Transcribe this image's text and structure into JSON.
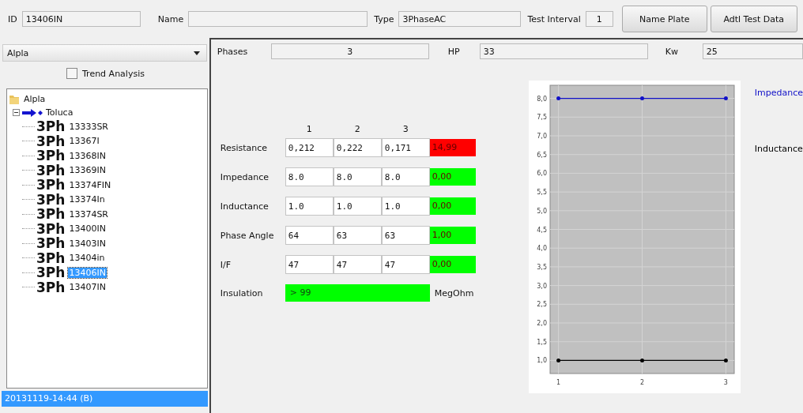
{
  "header": {
    "id_label": "ID",
    "id_value": "13406IN",
    "name_label": "Name",
    "type_label": "Type",
    "type_value": "3PhaseAC",
    "interval_label": "Test Interval",
    "interval_value": "1",
    "buttons": [
      "Name Plate",
      "Adtl Test Data"
    ]
  },
  "sidebar": {
    "site_select": "Alpla",
    "trend_analysis": {
      "label": "Trend Analysis",
      "checked": false
    },
    "tree": [
      {
        "label": "Alpla",
        "kind": "folder",
        "children": [
          {
            "label": "Toluca",
            "kind": "site",
            "expanded": true,
            "children": [
              {
                "type": "3Ph",
                "label": "13333SR",
                "selected": false
              },
              {
                "type": "3Ph",
                "label": "13367I",
                "selected": false
              },
              {
                "type": "3Ph",
                "label": "13368IN",
                "selected": false
              },
              {
                "type": "3Ph",
                "label": "13369IN",
                "selected": false
              },
              {
                "type": "3Ph",
                "label": "13374FIN",
                "selected": false
              },
              {
                "type": "3Ph",
                "label": "13374In",
                "selected": false
              },
              {
                "type": "3Ph",
                "label": "13374SR",
                "selected": false
              },
              {
                "type": "3Ph",
                "label": "13400IN",
                "selected": false
              },
              {
                "type": "3Ph",
                "label": "13403IN",
                "selected": false
              },
              {
                "type": "3Ph",
                "label": "13404in",
                "selected": false
              },
              {
                "type": "3Ph",
                "label": "13406IN",
                "selected": true
              },
              {
                "type": "3Ph",
                "label": "13407IN",
                "selected": false
              }
            ]
          }
        ]
      }
    ],
    "tests": [
      {
        "label": "20131119-14:44 (B)",
        "selected": true
      }
    ]
  },
  "motor": {
    "phases_label": "Phases",
    "phases_value": "3",
    "hp_label": "HP",
    "hp_value": "33",
    "kw_label": "Kw",
    "kw_value": "25"
  },
  "measurements": {
    "columns": [
      "1",
      "2",
      "3"
    ],
    "rows": [
      {
        "label": "Resistance",
        "values": [
          "0,212",
          "0,222",
          "0,171"
        ],
        "deviation": "14,99",
        "color": "#ff0000"
      },
      {
        "label": "Impedance",
        "values": [
          "8.0",
          "8.0",
          "8.0"
        ],
        "deviation": "0,00",
        "color": "#00ff00"
      },
      {
        "label": "Inductance",
        "values": [
          "1.0",
          "1.0",
          "1.0"
        ],
        "deviation": "0,00",
        "color": "#00ff00"
      },
      {
        "label": "Phase Angle",
        "values": [
          "64",
          "63",
          "63"
        ],
        "deviation": "1,00",
        "color": "#00ff00"
      },
      {
        "label": "I/F",
        "values": [
          "47",
          "47",
          "47"
        ],
        "deviation": "0,00",
        "color": "#00ff00"
      }
    ],
    "insulation": {
      "label": "Insulation",
      "value": "> 99",
      "unit": "MegOhm",
      "color": "#00ff00"
    }
  },
  "chart_data": {
    "type": "line",
    "grid": true,
    "x": [
      1,
      2,
      3
    ],
    "xlim": [
      0.9,
      3.1
    ],
    "ylim": [
      0.65,
      8.35
    ],
    "xticks": [
      1,
      2,
      3
    ],
    "yticks": [
      {
        "value": 1,
        "label": "1,0"
      },
      {
        "value": 1.5,
        "label": "1,5"
      },
      {
        "value": 2,
        "label": "2,0"
      },
      {
        "value": 2.5,
        "label": "2,5"
      },
      {
        "value": 3,
        "label": "3,0"
      },
      {
        "value": 3.5,
        "label": "3,5"
      },
      {
        "value": 4,
        "label": "4,0"
      },
      {
        "value": 4.5,
        "label": "4,5"
      },
      {
        "value": 5,
        "label": "5,0"
      },
      {
        "value": 5.5,
        "label": "5,5"
      },
      {
        "value": 6,
        "label": "6,0"
      },
      {
        "value": 6.5,
        "label": "6,5"
      },
      {
        "value": 7,
        "label": "7,0"
      },
      {
        "value": 7.5,
        "label": "7,5"
      },
      {
        "value": 8,
        "label": "8,0"
      }
    ],
    "series": [
      {
        "name": "Impedance",
        "color": "#1010c8",
        "values": [
          8,
          8,
          8
        ]
      },
      {
        "name": "Inductance",
        "color": "#000000",
        "values": [
          1,
          1,
          1
        ]
      }
    ]
  }
}
